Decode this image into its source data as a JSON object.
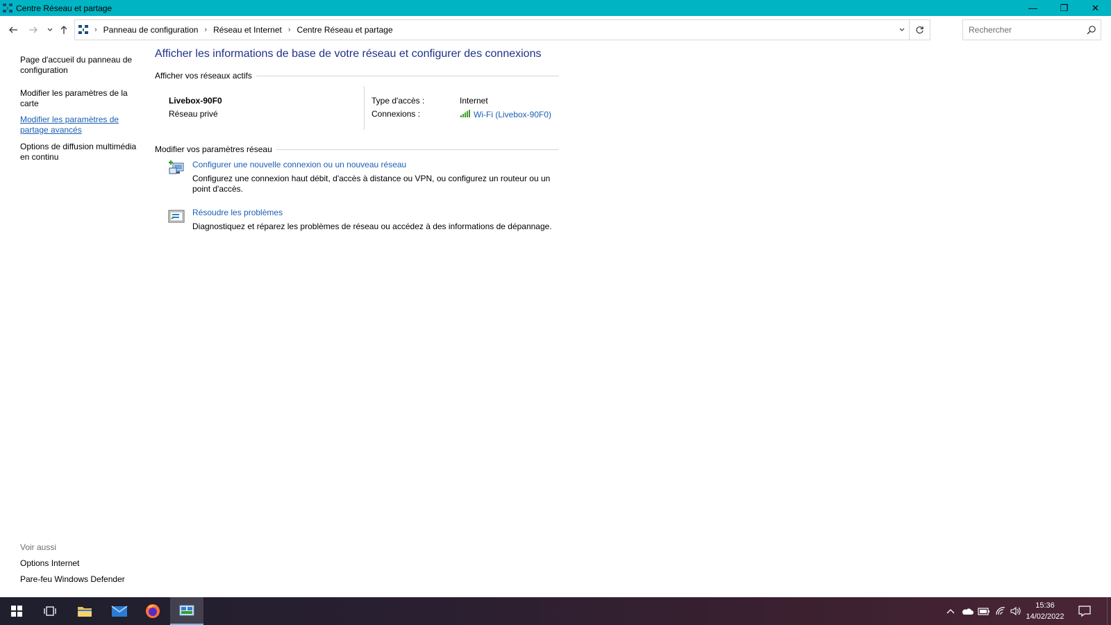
{
  "window": {
    "title": "Centre Réseau et partage",
    "controls": {
      "minimize": "—",
      "restore": "❐",
      "close": "✕"
    }
  },
  "nav": {
    "back_icon": "arrow-left-icon",
    "forward_icon": "arrow-right-icon",
    "recent_icon": "chevron-down-icon",
    "up_icon": "arrow-up-icon",
    "breadcrumbs": [
      "Panneau de configuration",
      "Réseau et Internet",
      "Centre Réseau et partage"
    ],
    "search_placeholder": "Rechercher"
  },
  "sidebar": {
    "links": [
      "Page d'accueil du panneau de configuration",
      "Modifier les paramètres de la carte",
      "Modifier les paramètres de partage avancés",
      "Options de diffusion multimédia en continu"
    ],
    "see_also_title": "Voir aussi",
    "see_also_links": [
      "Options Internet",
      "Pare-feu Windows Defender"
    ]
  },
  "main": {
    "heading": "Afficher les informations de base de votre réseau et configurer des connexions",
    "active_networks_title": "Afficher vos réseaux actifs",
    "network": {
      "name": "Livebox-90F0",
      "type": "Réseau privé",
      "access_type_label": "Type d'accès :",
      "access_type_value": "Internet",
      "connections_label": "Connexions :",
      "connection_link": "Wi-Fi (Livebox-90F0)"
    },
    "modify_title": "Modifier vos paramètres réseau",
    "tasks": [
      {
        "icon": "new-connection-icon",
        "link": "Configurer une nouvelle connexion ou un nouveau réseau",
        "description": "Configurez une connexion haut débit, d'accès à distance ou VPN, ou configurez un routeur ou un point d'accès."
      },
      {
        "icon": "troubleshoot-icon",
        "link": "Résoudre les problèmes",
        "description": "Diagnostiquez et réparez les problèmes de réseau ou accédez à des informations de dépannage."
      }
    ]
  },
  "taskbar": {
    "clock_time": "15:36",
    "clock_date": "14/02/2022"
  },
  "colors": {
    "titlebar": "#00b4c4",
    "link": "#1a5fb4",
    "heading": "#1e3287"
  }
}
